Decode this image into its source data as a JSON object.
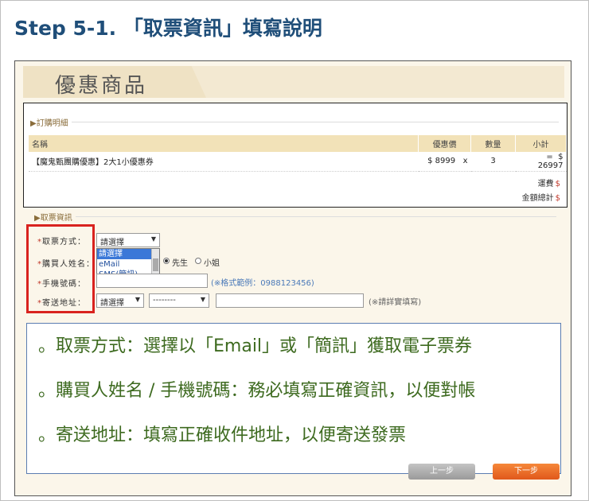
{
  "page_title": "Step 5-1. 「取票資訊」填寫說明",
  "header": {
    "title": "優惠商品"
  },
  "order": {
    "legend": "▶訂購明細",
    "columns": [
      "名稱",
      "優惠價",
      "數量",
      "小計"
    ],
    "row": {
      "name": "【魔鬼甄團購優惠】2大1小優惠券",
      "price": "$ 8999",
      "times": "x",
      "qty": "3",
      "equals": "=",
      "subtotal": "$ 26997"
    },
    "shipping_label": "運費",
    "shipping_currency": "$",
    "total_label": "金額總計",
    "total_currency": "$"
  },
  "ticket": {
    "legend": "▶取票資訊",
    "fields": {
      "pickup_method": {
        "req": "*",
        "label": "取票方式：",
        "value": "請選擇"
      },
      "buyer_name": {
        "req": "*",
        "label": "購買人姓名：",
        "gender_options": [
          "先生",
          "小姐"
        ],
        "gender_selected": "先生"
      },
      "phone": {
        "req": "*",
        "label": "手機號碼：",
        "hint": "(※格式範例：0988123456)"
      },
      "address": {
        "req": "*",
        "label": "寄送地址：",
        "city_value": "請選擇",
        "district_value": "--------",
        "hint": "(※請詳實填寫)"
      }
    },
    "dropdown_options": [
      "請選擇",
      "eMail",
      "SMS(簡訊)"
    ],
    "dropdown_selected": "請選擇"
  },
  "callout": {
    "lines": [
      "。取票方式：選擇以「Email」或「簡訊」獲取電子票券",
      "。購買人姓名 / 手機號碼：務必填寫正確資訊，以便對帳",
      "。寄送地址：填寫正確收件地址，以便寄送發票"
    ]
  },
  "buttons": {
    "prev": "上一步",
    "next": "下一步"
  },
  "colors": {
    "title_blue": "#1f4e79",
    "callout_green": "#3d6a1f",
    "highlight_red": "#d9231f",
    "next_orange": "#e0581b"
  }
}
